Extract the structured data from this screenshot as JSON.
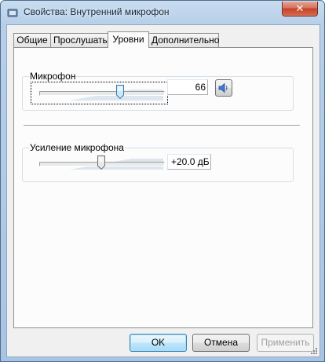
{
  "window": {
    "title": "Свойства: Внутренний микрофон"
  },
  "tabs": [
    {
      "label": "Общие",
      "active": false
    },
    {
      "label": "Прослушать",
      "active": false
    },
    {
      "label": "Уровни",
      "active": true
    },
    {
      "label": "Дополнительно",
      "active": false
    }
  ],
  "microphone": {
    "label": "Микрофон",
    "level_value": "66",
    "level_fraction": 0.66,
    "mute_icon": "speaker-icon"
  },
  "boost": {
    "label": "Усиление микрофона",
    "value": "+20.0 дБ",
    "level_fraction": 0.5
  },
  "buttons": {
    "ok": "OK",
    "cancel": "Отмена",
    "apply": "Применить"
  },
  "colors": {
    "default_button_border": "#3c7fb1",
    "close_button": "#c3422b"
  }
}
